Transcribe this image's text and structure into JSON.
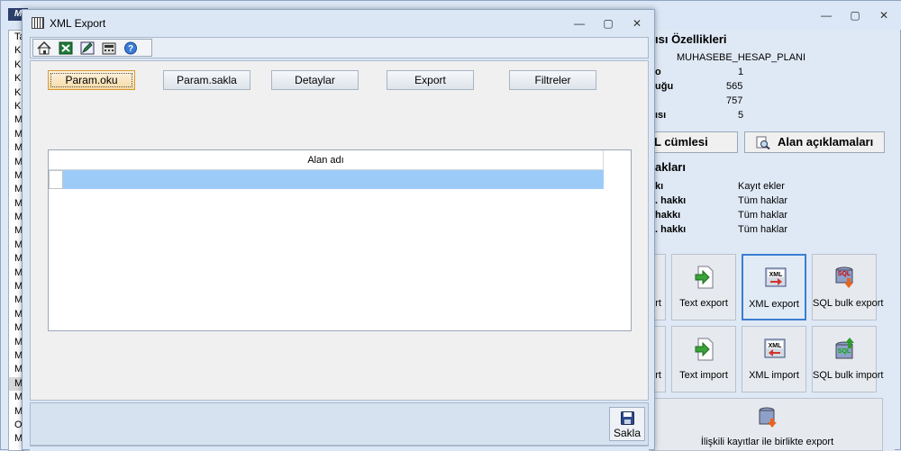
{
  "main_window": {
    "logo_text": "M",
    "left_list": [
      "Ta",
      "Ki",
      "Ki",
      "Ki",
      "Ki",
      "Ki",
      "M",
      "M",
      "M",
      "M",
      "M",
      "M",
      "M",
      "M",
      "M",
      "M",
      "M",
      "M",
      "M",
      "M",
      "M",
      "M",
      "M",
      "M",
      "M",
      "M",
      "M",
      "M",
      "O",
      "M"
    ],
    "left_list_selected_index": 25,
    "properties": {
      "title": "ısı Özellikleri",
      "name_value": "MUHASEBE_HESAP_PLANI",
      "rows": [
        {
          "key": "o",
          "value": "1"
        },
        {
          "key": "uğu",
          "value": "565"
        },
        {
          "key": "",
          "value": "757"
        },
        {
          "key": "ısı",
          "value": "5"
        }
      ]
    },
    "sql_button": "L cümlesi",
    "fields_button": "Alan açıklamaları",
    "rights": {
      "title": "akları",
      "rows": [
        {
          "key": "kı",
          "value": "Kayıt ekler"
        },
        {
          "key": ". hakkı",
          "value": "Tüm haklar"
        },
        {
          "key": "hakkı",
          "value": "Tüm haklar"
        },
        {
          "key": ". hakkı",
          "value": "Tüm haklar"
        }
      ]
    },
    "tiles": [
      {
        "label": "rt",
        "icon": "partial-export-icon"
      },
      {
        "label": "Text export",
        "icon": "text-export-icon"
      },
      {
        "label": "XML export",
        "icon": "xml-export-icon",
        "badge": "XML"
      },
      {
        "label": "SQL bulk export",
        "icon": "sql-bulk-export-icon",
        "badge": "SQL"
      },
      {
        "label": "rt",
        "icon": "partial-import-icon"
      },
      {
        "label": "Text import",
        "icon": "text-import-icon"
      },
      {
        "label": "XML import",
        "icon": "xml-import-icon",
        "badge": "XML"
      },
      {
        "label": "SQL bulk import",
        "icon": "sql-bulk-import-icon",
        "badge": "SQL"
      }
    ],
    "related_export_label": "İlişkili kayıtlar ile birlikte export"
  },
  "dialog": {
    "title": "XML Export",
    "toolbar_icons": [
      "home-icon",
      "excel-icon",
      "edit-icon",
      "calculator-icon",
      "help-icon"
    ],
    "buttons": {
      "load": "Param.oku",
      "save_params": "Param.sakla",
      "details": "Detaylar",
      "export": "Export",
      "filters": "Filtreler"
    },
    "grid": {
      "column_header": "Alan adı"
    },
    "save_label": "Sakla"
  },
  "colors": {
    "accent": "#3b7ed2",
    "selected_row": "#9ccbf7",
    "focused_button": "#f5d9a4"
  }
}
